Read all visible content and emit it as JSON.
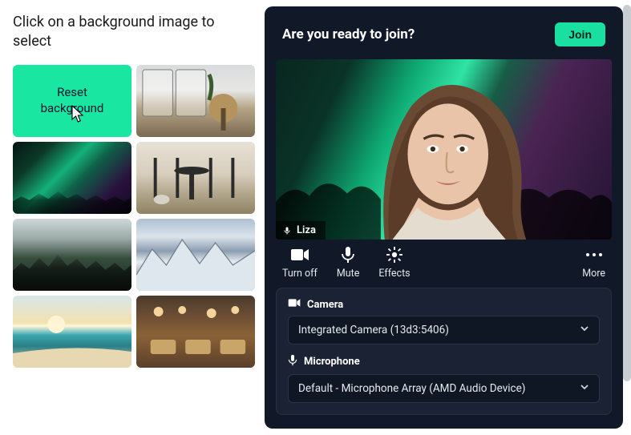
{
  "left": {
    "title": "Click on a background image to select",
    "reset_label": "Reset\nbackground",
    "tiles": [
      {
        "name": "reset"
      },
      {
        "name": "cafe-interior"
      },
      {
        "name": "aurora"
      },
      {
        "name": "outdoor-chairs"
      },
      {
        "name": "forest-valley"
      },
      {
        "name": "snow-mountains"
      },
      {
        "name": "sunset-beach"
      },
      {
        "name": "restaurant"
      }
    ]
  },
  "preview": {
    "ready_text": "Are you ready to join?",
    "join_label": "Join",
    "participant_name": "Liza",
    "controls": {
      "camera_label": "Turn off",
      "mic_label": "Mute",
      "effects_label": "Effects",
      "more_label": "More"
    },
    "settings": {
      "camera_label": "Camera",
      "camera_value": "Integrated Camera (13d3:5406)",
      "microphone_label": "Microphone",
      "microphone_value": "Default - Microphone Array (AMD Audio Device)"
    }
  },
  "colors": {
    "accent": "#19e0a0"
  }
}
